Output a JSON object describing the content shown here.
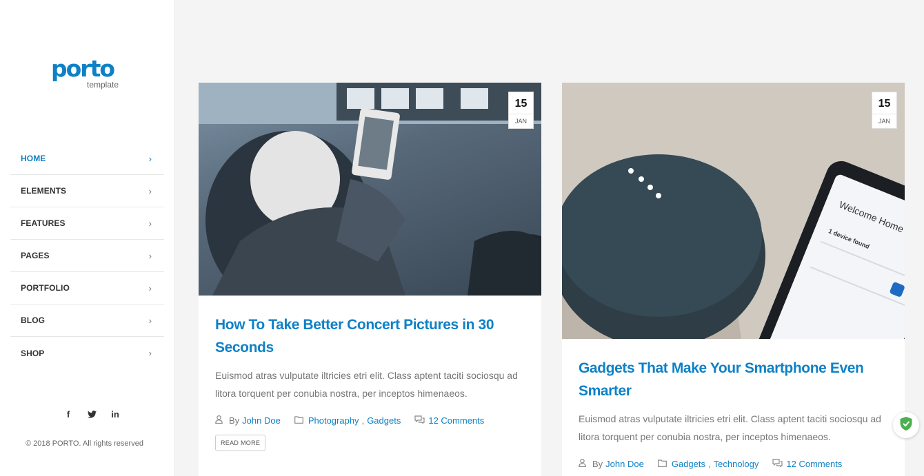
{
  "logo": {
    "word": "porto",
    "sub": "template"
  },
  "nav": [
    {
      "label": "HOME",
      "active": true
    },
    {
      "label": "ELEMENTS"
    },
    {
      "label": "FEATURES"
    },
    {
      "label": "PAGES"
    },
    {
      "label": "PORTFOLIO"
    },
    {
      "label": "BLOG"
    },
    {
      "label": "SHOP"
    }
  ],
  "social": {
    "facebook": "f",
    "twitter": "twitter",
    "linkedin": "in"
  },
  "copyright": "© 2018 PORTO. All rights reserved",
  "posts": [
    {
      "day": "15",
      "month": "JAN",
      "title": "How To Take Better Concert Pictures in 30 Seconds",
      "excerpt": "Euismod atras vulputate iltricies etri elit. Class aptent taciti sociosqu ad litora torquent per conubia nostra, per inceptos himenaeos.",
      "by": "By",
      "author": "John Doe",
      "cat1": "Photography",
      "sep": ",",
      "cat2": "Gadgets",
      "comments": "12 Comments",
      "read_more": "READ MORE"
    },
    {
      "day": "15",
      "month": "JAN",
      "title": "Gadgets That Make Your Smartphone Even Smarter",
      "excerpt": "Euismod atras vulputate iltricies etri elit. Class aptent taciti sociosqu ad litora torquent per conubia nostra, per inceptos himenaeos.",
      "by": "By",
      "author": "John Doe",
      "cat1": "Gadgets",
      "sep": ",",
      "cat2": "Technology",
      "comments": "12 Comments",
      "phone_text": "Welcome Home",
      "phone_sub": "1 device found"
    }
  ],
  "colors": {
    "accent": "#0e81c6",
    "text": "#777777",
    "heading": "#333333"
  }
}
